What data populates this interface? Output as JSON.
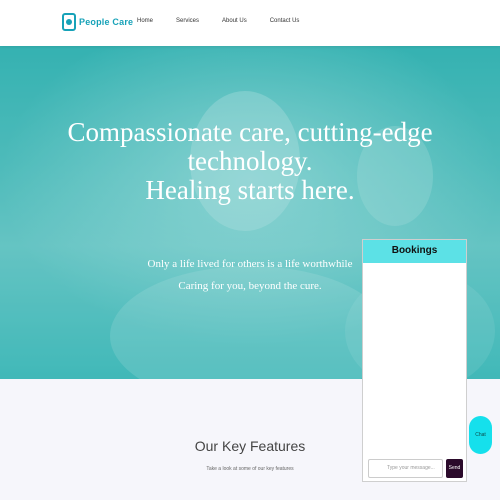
{
  "brand": {
    "name": "People Care"
  },
  "nav": {
    "links": [
      "Home",
      "Services",
      "About Us",
      "Contact Us"
    ]
  },
  "hero": {
    "title_lines": [
      "Compassionate care, cutting-edge",
      "technology.",
      "Healing starts here."
    ],
    "subtitle_lines": [
      "Only a life lived for others is a life worthwhile",
      "Caring for you, beyond the cure."
    ]
  },
  "features": {
    "title": "Our Key Features",
    "subtitle": "Take a look at some of our key features"
  },
  "bookings": {
    "title": "Bookings",
    "input_placeholder": "Type your message...",
    "send_label": "Send"
  },
  "chat_bubble": {
    "label": "Chat"
  },
  "colors": {
    "brand_teal": "#17a2b8",
    "bookings_header": "#5ce1e6",
    "send_button": "#2b0a2b",
    "chat_bubble": "#15e0ec"
  }
}
